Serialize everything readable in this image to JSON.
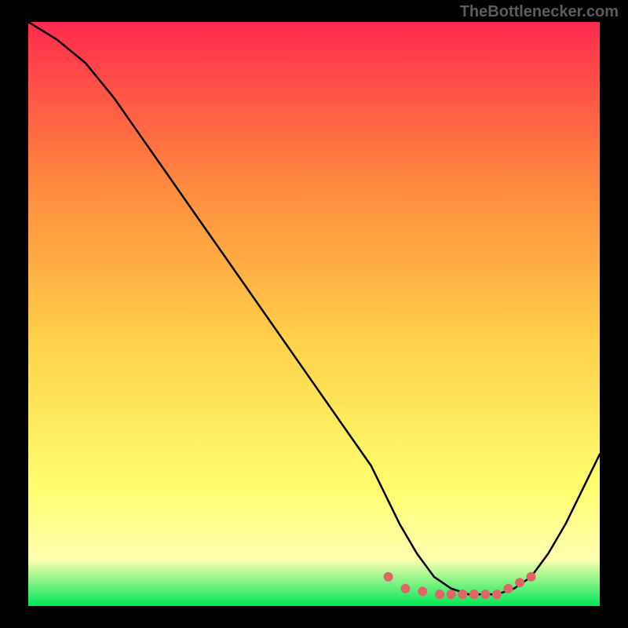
{
  "watermark": "TheBottlenecker.com",
  "colors": {
    "frame_bg": "#000000",
    "gradient_top": "#ff2b4e",
    "gradient_mid_upper": "#ff8a3d",
    "gradient_mid": "#ffd24a",
    "gradient_mid_lower": "#ffff70",
    "gradient_near_bottom": "#ffffb0",
    "gradient_bottom": "#00e756",
    "curve": "#000000",
    "dots": "#e06666"
  },
  "chart_data": {
    "type": "line",
    "title": "",
    "xlabel": "",
    "ylabel": "",
    "xlim": [
      0,
      100
    ],
    "ylim": [
      0,
      100
    ],
    "curve": {
      "name": "bottleneck-curve",
      "x": [
        0,
        5,
        10,
        15,
        20,
        25,
        30,
        35,
        40,
        45,
        50,
        55,
        60,
        62,
        65,
        68,
        71,
        74,
        77,
        80,
        82,
        85,
        88,
        91,
        94,
        97,
        100
      ],
      "y": [
        100,
        97,
        93,
        87,
        80,
        73,
        66,
        59,
        52,
        45,
        38,
        31,
        24,
        20,
        14,
        9,
        5,
        3,
        2,
        2,
        2,
        3,
        5,
        9,
        14,
        20,
        26
      ]
    },
    "dots": {
      "name": "optimal-range-markers",
      "x": [
        63,
        66,
        69,
        72,
        74,
        76,
        78,
        80,
        82,
        84,
        86,
        88
      ],
      "y": [
        5,
        3,
        2.5,
        2,
        2,
        2,
        2,
        2,
        2,
        3,
        4,
        5
      ]
    },
    "legend": [],
    "grid": false
  }
}
